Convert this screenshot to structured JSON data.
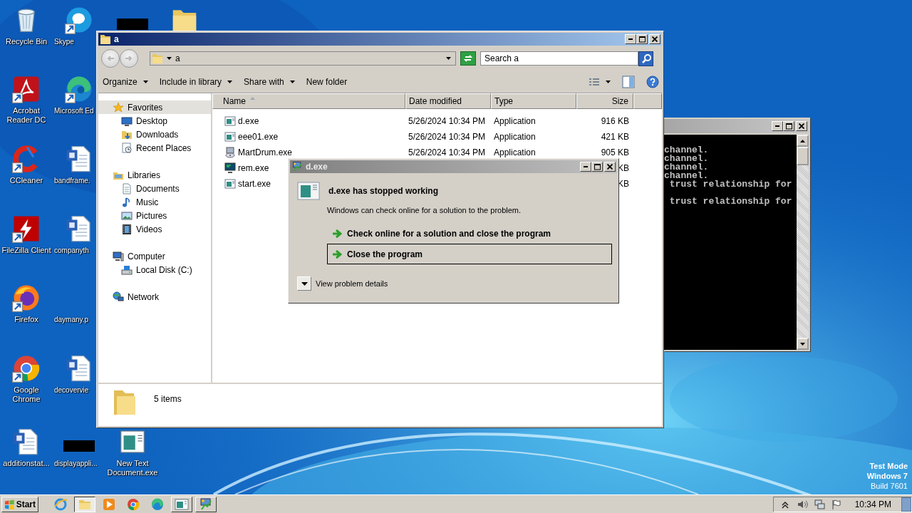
{
  "desktop": {
    "icons": [
      {
        "label": "Recycle Bin",
        "kind": "recycle-bin",
        "shortcut": false
      },
      {
        "label": "Acrobat Reader DC",
        "kind": "acrobat",
        "shortcut": true
      },
      {
        "label": "CCleaner",
        "kind": "ccleaner",
        "shortcut": true
      },
      {
        "label": "FileZilla Client",
        "kind": "filezilla",
        "shortcut": true
      },
      {
        "label": "Firefox",
        "kind": "firefox",
        "shortcut": true
      },
      {
        "label": "Google Chrome",
        "kind": "chrome",
        "shortcut": true
      },
      {
        "label": "additionstat...",
        "kind": "word",
        "shortcut": false
      },
      {
        "label": "Skype",
        "kind": "skype",
        "shortcut": true
      },
      {
        "label": "Microsoft Ed",
        "kind": "edge",
        "shortcut": true
      },
      {
        "label": "bandframe.",
        "kind": "word",
        "shortcut": false
      },
      {
        "label": "companyth",
        "kind": "word",
        "shortcut": false
      },
      {
        "label": "daymany.p",
        "kind": "none",
        "shortcut": false
      },
      {
        "label": "decovervie",
        "kind": "word",
        "shortcut": false
      },
      {
        "label": "displayappli...",
        "kind": "redacted",
        "shortcut": false
      },
      {
        "kind": "redacted",
        "shortcut": false
      },
      {
        "label": "New Text Document.exe",
        "kind": "exe",
        "shortcut": false
      },
      {
        "kind": "folder",
        "shortcut": false
      }
    ],
    "test_mode": [
      "Test Mode",
      "Windows 7",
      "Build 7601"
    ]
  },
  "explorer": {
    "title": "a",
    "address": "a",
    "search": {
      "placeholder": "Search a"
    },
    "toolbar": [
      {
        "label": "Organize",
        "dropdown": true
      },
      {
        "label": "Include in library",
        "dropdown": true
      },
      {
        "label": "Share with",
        "dropdown": true
      },
      {
        "label": "New folder",
        "dropdown": false
      }
    ],
    "navigation": [
      {
        "label": "Favorites",
        "kind": "star",
        "selected": true,
        "children": [
          {
            "label": "Desktop",
            "kind": "desktop",
            "selected": false
          },
          {
            "label": "Downloads",
            "kind": "downloads",
            "selected": false
          },
          {
            "label": "Recent Places",
            "kind": "recent",
            "selected": false
          }
        ]
      },
      {
        "label": "Libraries",
        "kind": "libraries",
        "selected": false,
        "children": [
          {
            "label": "Documents",
            "kind": "documents",
            "selected": false
          },
          {
            "label": "Music",
            "kind": "music",
            "selected": false
          },
          {
            "label": "Pictures",
            "kind": "pictures",
            "selected": false
          },
          {
            "label": "Videos",
            "kind": "videos",
            "selected": false
          }
        ]
      },
      {
        "label": "Computer",
        "kind": "computer",
        "selected": false,
        "children": [
          {
            "label": "Local Disk (C:)",
            "kind": "disk",
            "selected": false
          }
        ]
      },
      {
        "label": "Network",
        "kind": "network",
        "selected": false
      }
    ],
    "columns": [
      {
        "label": "Name",
        "sorted": true
      },
      {
        "label": "Date modified",
        "sorted": false
      },
      {
        "label": "Type",
        "sorted": false
      },
      {
        "label": "Size",
        "sorted": false
      }
    ],
    "rows": [
      {
        "name": "d.exe",
        "kind": "exe",
        "date_modified": "5/26/2024 10:34 PM",
        "type": "Application",
        "size": "916 KB"
      },
      {
        "name": "eee01.exe",
        "kind": "exe",
        "date_modified": "5/26/2024 10:34 PM",
        "type": "Application",
        "size": "421 KB"
      },
      {
        "name": "MartDrum.exe",
        "kind": "installer",
        "date_modified": "5/26/2024 10:34 PM",
        "type": "Application",
        "size": "905 KB"
      },
      {
        "name": "rem.exe",
        "kind": "monitor",
        "size": "KB"
      },
      {
        "name": "start.exe",
        "kind": "exe",
        "size": "KB"
      }
    ],
    "status": "5 items"
  },
  "console": {
    "blocks": [
      {
        "lines": [
          "channel.",
          "channel.",
          "channel.",
          "channel.",
          " trust relationship for"
        ]
      },
      {
        "lines": [
          " trust relationship for"
        ]
      }
    ]
  },
  "dialog": {
    "title": "d.exe",
    "heading": "d.exe has stopped working",
    "message": "Windows can check online for a solution to the problem.",
    "options": [
      {
        "label": "Check online for a solution and close the program",
        "selected": false
      },
      {
        "label": "Close the program",
        "selected": true
      }
    ],
    "details": {
      "label": "View problem details",
      "expanded": false
    }
  },
  "taskbar": {
    "start": "Start",
    "items": [
      {
        "kind": "ie",
        "running": false,
        "active": false
      },
      {
        "kind": "explorer",
        "running": true,
        "active": true
      },
      {
        "kind": "media",
        "running": false,
        "active": false
      },
      {
        "kind": "chrome",
        "running": false,
        "active": false
      },
      {
        "kind": "edge",
        "running": false,
        "active": false
      },
      {
        "kind": "exe",
        "running": true,
        "active": false
      },
      {
        "kind": "installer",
        "running": true,
        "active": false
      }
    ],
    "tray": [
      {
        "kind": "chevron"
      },
      {
        "kind": "volume"
      },
      {
        "kind": "network"
      },
      {
        "kind": "flag"
      }
    ],
    "clock": "10:34 PM"
  }
}
